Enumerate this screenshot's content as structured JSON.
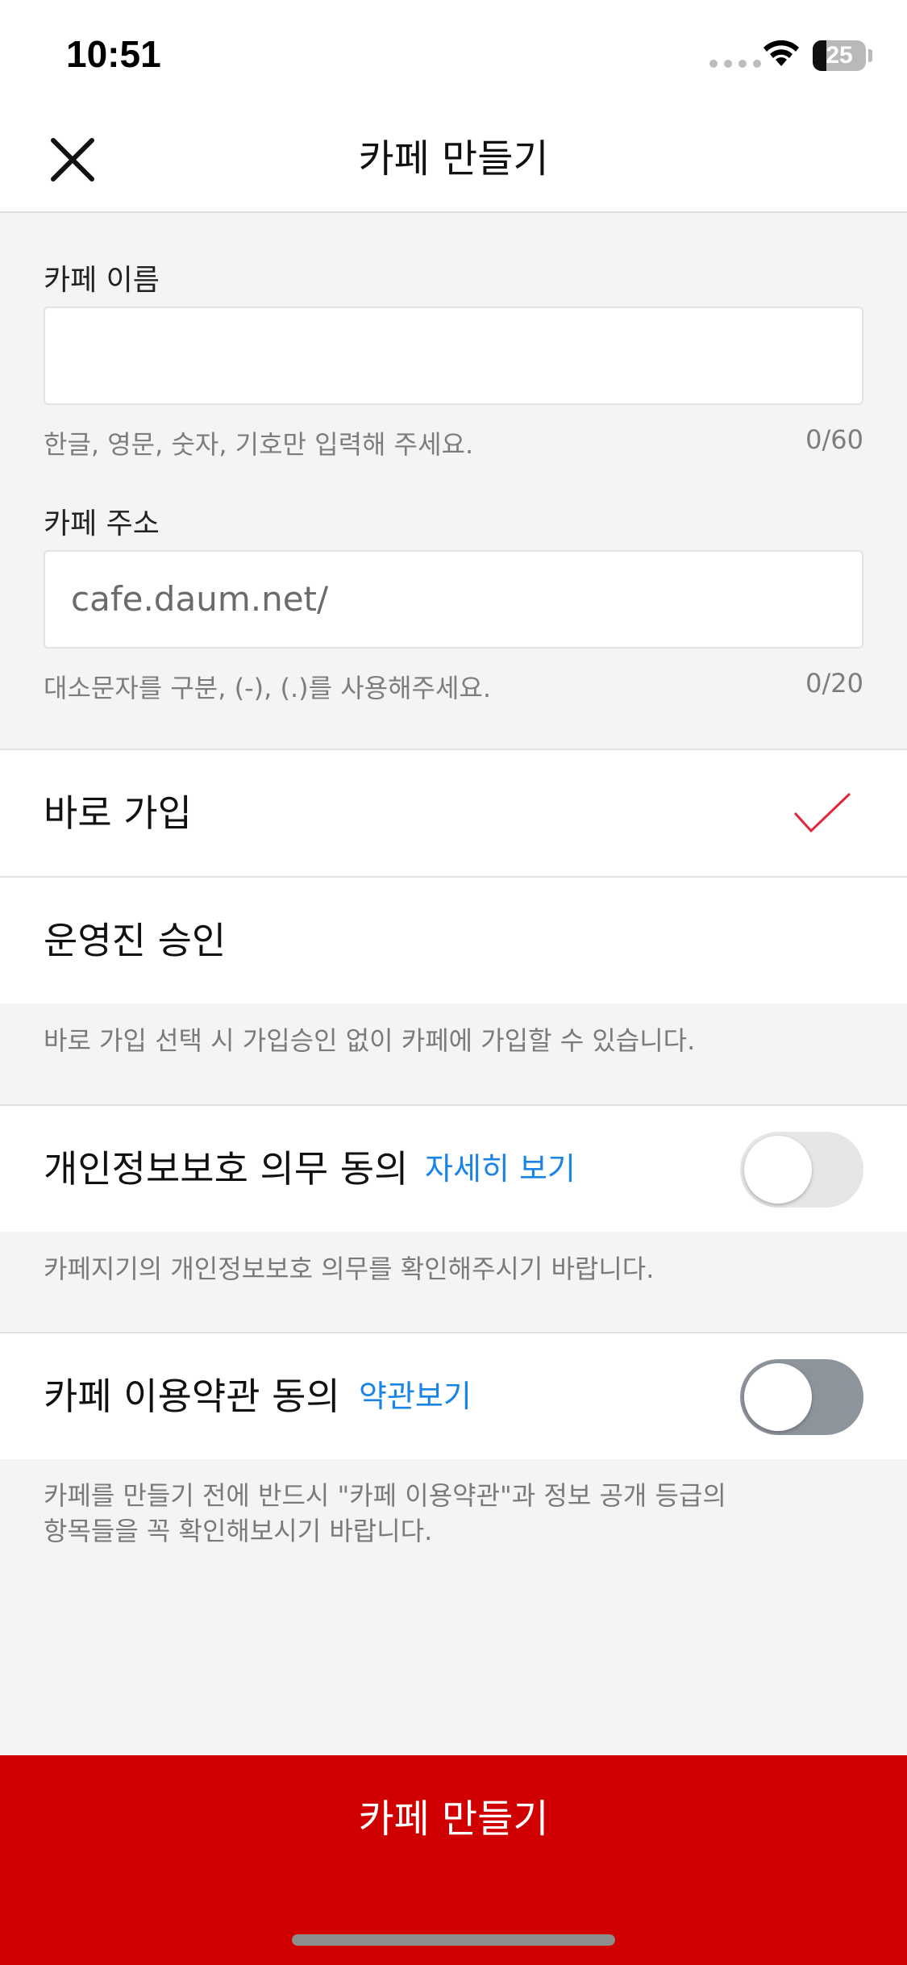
{
  "status_bar": {
    "time": "10:51",
    "battery_level": "25",
    "battery_fraction": 0.25
  },
  "nav": {
    "title": "카페 만들기",
    "close_icon": "close-icon"
  },
  "form": {
    "name_field": {
      "label": "카페 이름",
      "value": "",
      "hint": "한글, 영문, 숫자, 기호만 입력해 주세요.",
      "counter": "0/60"
    },
    "address_field": {
      "label": "카페 주소",
      "prefix": "cafe.daum.net/",
      "hint": "대소문자를 구분, (-), (.)를 사용해주세요.",
      "counter": "0/20"
    }
  },
  "join_options": {
    "items": [
      {
        "label": "바로 가입",
        "selected": true
      },
      {
        "label": "운영진 승인",
        "selected": false
      }
    ],
    "note": "바로 가입 선택 시 가입승인 없이 카페에 가입할 수 있습니다."
  },
  "privacy_agreement": {
    "label": "개인정보보호 의무 동의",
    "link": "자세히 보기",
    "toggled": false,
    "note": "카페지기의 개인정보보호 의무를 확인해주시기 바랍니다."
  },
  "terms_agreement": {
    "label": "카페 이용약관 동의",
    "link": "약관보기",
    "toggled": false,
    "note_line1": "카페를 만들기 전에 반드시 \"카페 이용약관\"과 정보 공개 등급의",
    "note_line2": "항목들을 꼭 확인해보시기 바랍니다."
  },
  "submit": {
    "label": "카페 만들기"
  },
  "colors": {
    "accent_red": "#d10000",
    "check_red": "#e0263a",
    "link_blue": "#1a84e6",
    "toggle_off_light": "#e6e6e6",
    "toggle_off_dark": "#8e949c"
  }
}
